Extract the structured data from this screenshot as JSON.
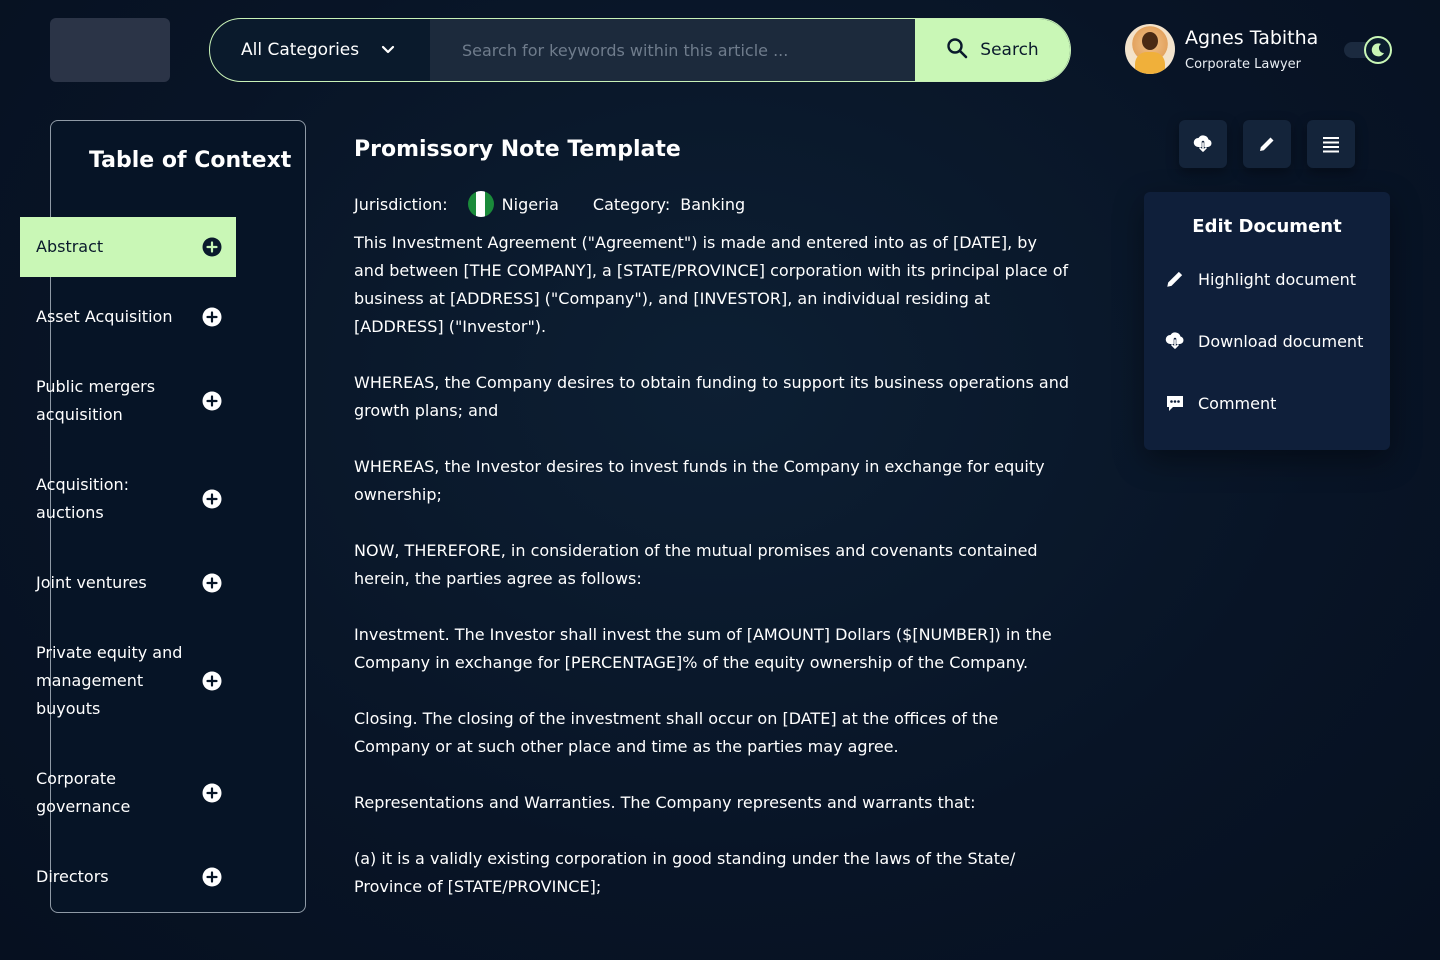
{
  "header": {
    "category_select": "All Categories",
    "search_placeholder": "Search for keywords within this article ...",
    "search_button": "Search"
  },
  "user": {
    "name": "Agnes Tabitha",
    "role": "Corporate Lawyer"
  },
  "sidebar": {
    "title": "Table of Context",
    "items": [
      {
        "label": "Abstract"
      },
      {
        "label": "Asset Acquisition"
      },
      {
        "label": "Public mergers acquisition"
      },
      {
        "label": "Acquisition: auctions"
      },
      {
        "label": "Joint ventures"
      },
      {
        "label": "Private equity and management buyouts"
      },
      {
        "label": "Corporate governance"
      },
      {
        "label": "Directors"
      }
    ]
  },
  "document": {
    "title": "Promissory Note Template",
    "jurisdiction_label": "Jurisdiction:",
    "jurisdiction_value": "Nigeria",
    "category_label": "Category:",
    "category_value": "Banking",
    "paragraphs": [
      "This Investment Agreement (\"Agreement\") is made and entered into as of [DATE], by and between [THE COMPANY], a [STATE/PROVINCE] corporation with its principal place of business at [ADDRESS] (\"Company\"), and [INVESTOR], an individual residing at [ADDRESS] (\"Investor\").",
      "WHEREAS, the Company desires to obtain funding to support its business operations and growth plans; and",
      "WHEREAS, the Investor desires to invest funds in the Company in exchange for equity ownership;",
      "NOW, THEREFORE, in consideration of the mutual promises and covenants contained herein, the parties agree as follows:",
      "Investment. The Investor shall invest the sum of [AMOUNT] Dollars ($[NUMBER]) in the Company in exchange for [PERCENTAGE]% of the equity ownership of the Company.",
      "Closing. The closing of the investment shall occur on [DATE] at the offices of the Company or at such other place and time as the parties may agree.",
      "Representations and Warranties. The Company represents and warrants that:",
      "(a) it is a validly existing corporation in good standing under the laws of the State/ Province of [STATE/PROVINCE];"
    ]
  },
  "edit_panel": {
    "title": "Edit Document",
    "items": [
      {
        "label": "Highlight document",
        "icon": "pencil-icon"
      },
      {
        "label": "Download document",
        "icon": "cloud-download-icon"
      },
      {
        "label": "Comment",
        "icon": "comment-icon"
      }
    ]
  },
  "colors": {
    "accent": "#c9f7b6",
    "background": "#081426",
    "panel": "#0f1f3a",
    "flag_green": "#1a8a3a",
    "flag_white": "#ffffff"
  }
}
